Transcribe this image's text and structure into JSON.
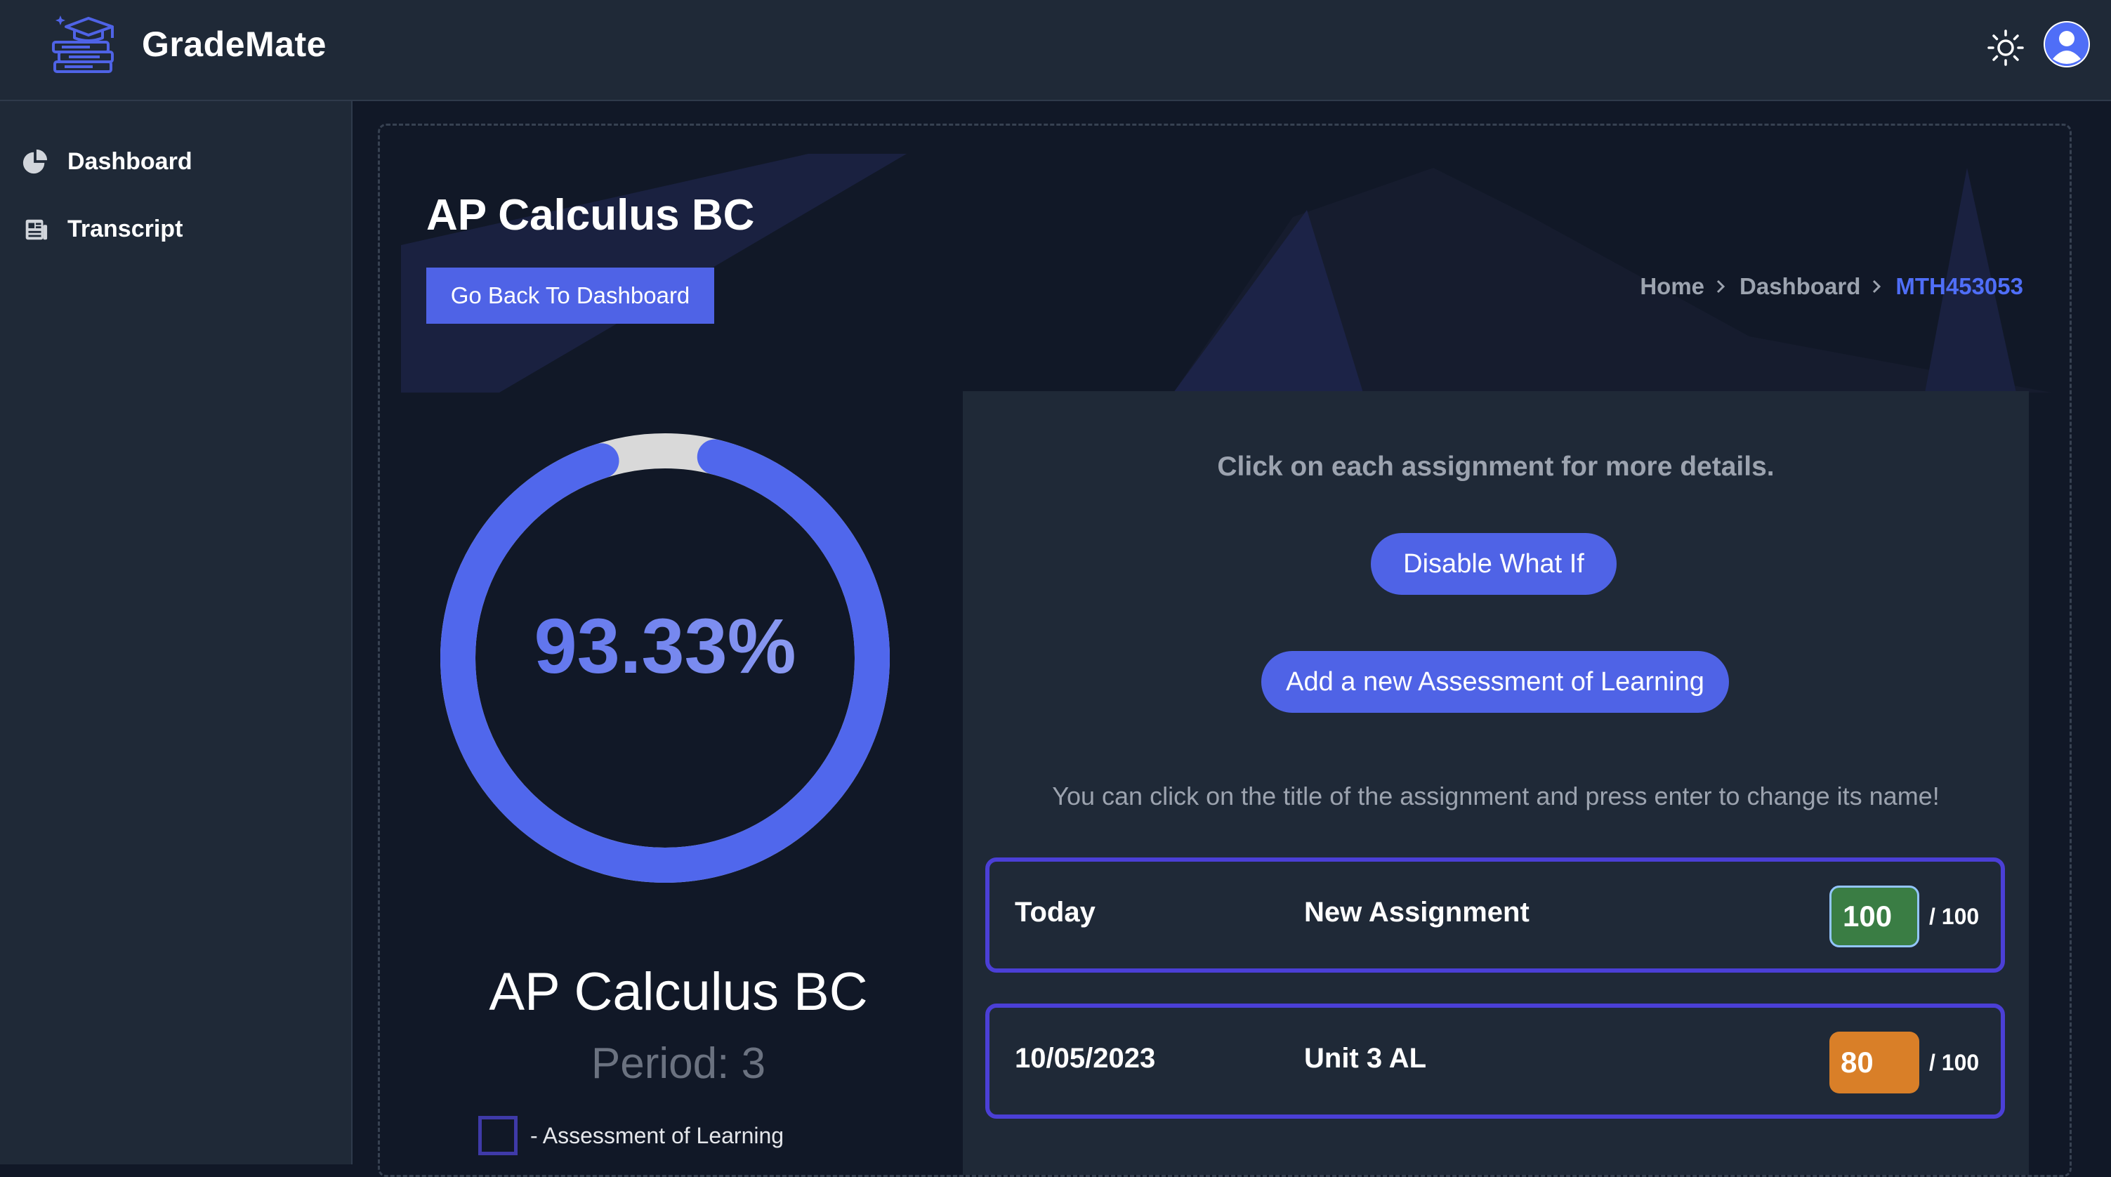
{
  "app": {
    "name": "GradeMate"
  },
  "sidebar": {
    "items": [
      {
        "label": "Dashboard",
        "icon": "pie-chart-icon"
      },
      {
        "label": "Transcript",
        "icon": "newspaper-icon"
      }
    ]
  },
  "header": {
    "theme_icon": "sun-icon",
    "avatar_icon": "user-avatar-icon"
  },
  "page": {
    "title": "AP Calculus BC",
    "back_button": "Go Back To Dashboard",
    "breadcrumb": [
      "Home",
      "Dashboard",
      "MTH453053"
    ]
  },
  "grade": {
    "percent_text": "93.33%",
    "percent_value": 93.33,
    "course_name": "AP Calculus BC",
    "period": "Period: 3",
    "legend_label": "- Assessment of Learning"
  },
  "assignments_panel": {
    "hint": "Click on each assignment for more details.",
    "whatif_button": "Disable What If",
    "add_button": "Add a new Assessment of Learning",
    "rename_hint": "You can click on the title of the assignment and press enter to change its name!",
    "rows": [
      {
        "date": "Today",
        "title": "New Assignment",
        "score": "100",
        "max": "/ 100",
        "status_color": "#3a7d44"
      },
      {
        "date": "10/05/2023",
        "title": "Unit 3 AL",
        "score": "80",
        "max": "/ 100",
        "status_color": "#d97f28"
      }
    ]
  },
  "colors": {
    "accent": "#4f63e6",
    "breadcrumb_current": "#4f6ef7",
    "background": "#111827",
    "panel": "#1f2937",
    "row_border": "#4b3fd6"
  }
}
